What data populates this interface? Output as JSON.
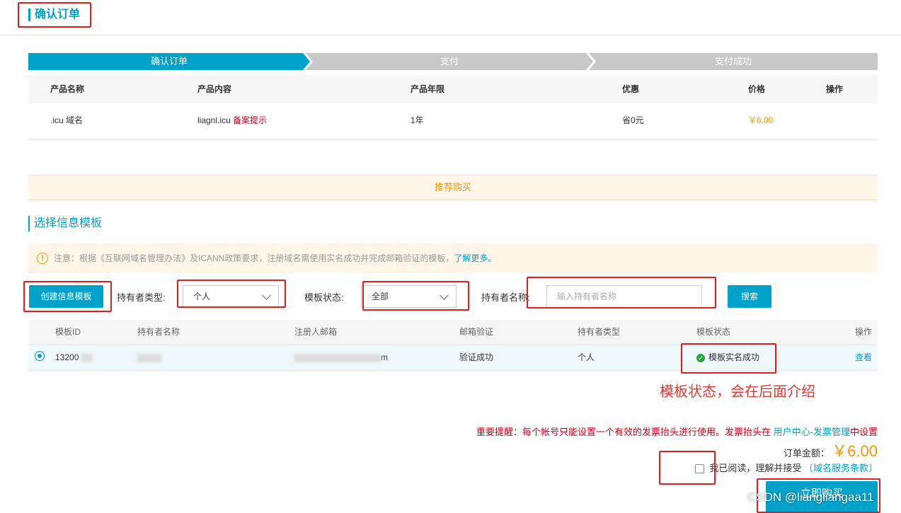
{
  "header": {
    "title": "确认订单"
  },
  "steps": [
    "确认订单",
    "支付",
    "支付成功"
  ],
  "order_table": {
    "headers": [
      "产品名称",
      "产品内容",
      "产品年限",
      "优惠",
      "价格",
      "操作"
    ],
    "row": {
      "name": ".icu 域名",
      "content": "liagnl.icu",
      "record_tip": "备案提示",
      "term": "1年",
      "discount": "省0元",
      "price": "￥6.00"
    }
  },
  "recommend": {
    "label": "推荐购买"
  },
  "template_section": {
    "title": "选择信息模板",
    "notice_text": "注意：根据《互联网域名管理办法》及ICANN政策要求，注册域名需使用实名成功并完成邮箱验证的模板，",
    "notice_link": "了解更多。",
    "create_button": "创建信息模板",
    "owner_type_label": "持有者类型:",
    "owner_type_value": "个人",
    "status_label": "模板状态:",
    "status_value": "全部",
    "owner_name_label": "持有者名称:",
    "owner_name_placeholder": "输入持有者名称",
    "search_button": "搜索"
  },
  "template_table": {
    "headers": [
      "模板ID",
      "持有者名称",
      "注册人邮箱",
      "邮箱验证",
      "持有者类型",
      "模板状态",
      "操作"
    ],
    "row": {
      "id": "13200",
      "email_suffix": "m",
      "email_verify": "验证成功",
      "owner_type": "个人",
      "status": "模板实名成功",
      "action": "查看"
    }
  },
  "annotation": "模板状态，会在后面介绍",
  "footer": {
    "reminder": "重要提醒：每个帐号只能设置一个有效的发票抬头进行使用。发票抬头在",
    "reminder_link": "用户中心-发票管理",
    "reminder_end": "中设置",
    "total_label": "订单金额：",
    "total_value": "￥6.00",
    "agree_text": "我已阅读，理解并接受",
    "terms_link": "〔域名服务条款〕",
    "buy_button": "立即购买"
  },
  "watermark": "CSDN @liangliangaa11",
  "colors": {
    "accent": "#00a2ca",
    "price": "#f39800",
    "alert": "#d0021b",
    "annotation": "#e02020"
  }
}
